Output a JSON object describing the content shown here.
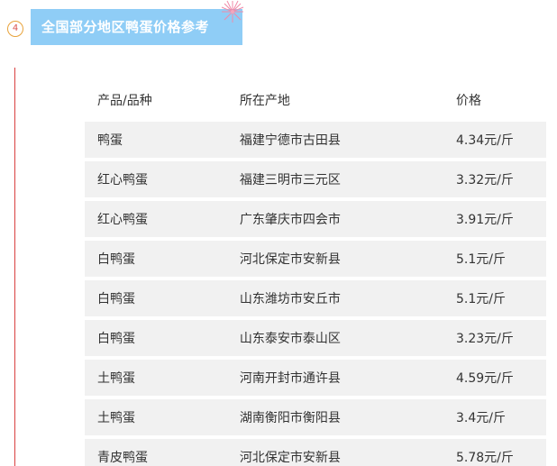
{
  "section": {
    "step_number": "4",
    "title": "全国部分地区鸭蛋价格参考"
  },
  "table": {
    "headers": [
      "产品/品种",
      "所在产地",
      "价格"
    ],
    "rows": [
      [
        "鸭蛋",
        "福建宁德市古田县",
        "4.34元/斤"
      ],
      [
        "红心鸭蛋",
        "福建三明市三元区",
        "3.32元/斤"
      ],
      [
        "红心鸭蛋",
        "广东肇庆市四会市",
        "3.91元/斤"
      ],
      [
        "白鸭蛋",
        "河北保定市安新县",
        "5.1元/斤"
      ],
      [
        "白鸭蛋",
        "山东潍坊市安丘市",
        "5.1元/斤"
      ],
      [
        "白鸭蛋",
        "山东泰安市泰山区",
        "3.23元/斤"
      ],
      [
        "土鸭蛋",
        "河南开封市通许县",
        "4.59元/斤"
      ],
      [
        "土鸭蛋",
        "湖南衡阳市衡阳县",
        "3.4元/斤"
      ],
      [
        "青皮鸭蛋",
        "河北保定市安新县",
        "5.78元/斤"
      ]
    ]
  },
  "colors": {
    "banner_background": "#8fcdf6",
    "banner_text": "#ffffff",
    "row_background": "#f1f1f1",
    "accent_rule": "#d94040",
    "badge_ring": "#e8a23a",
    "badge_text": "#d9534f"
  },
  "icons": {
    "decoration": "sparkle-icon"
  }
}
